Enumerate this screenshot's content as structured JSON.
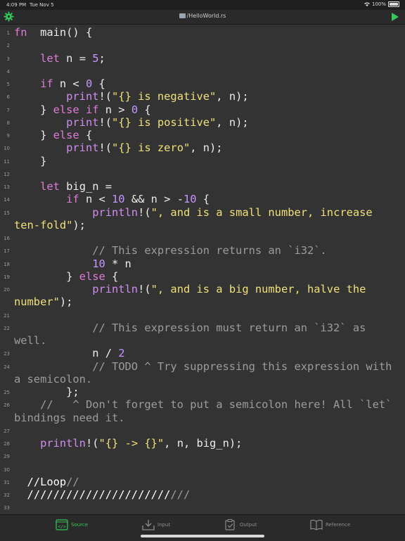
{
  "status_bar": {
    "time": "4:09 PM",
    "date": "Tue Nov 5",
    "battery": "100%"
  },
  "title_bar": {
    "file_path": "/HelloWorld.rs"
  },
  "code_lines": [
    {
      "n": "1",
      "parts": [
        [
          "kw",
          "fn"
        ],
        [
          "",
          "  main() {"
        ]
      ]
    },
    {
      "n": "2",
      "parts": []
    },
    {
      "n": "3",
      "parts": [
        [
          "",
          "    "
        ],
        [
          "kw",
          "let"
        ],
        [
          "",
          " n = "
        ],
        [
          "num",
          "5"
        ],
        [
          "",
          ";"
        ]
      ]
    },
    {
      "n": "4",
      "parts": []
    },
    {
      "n": "5",
      "parts": [
        [
          "",
          "    "
        ],
        [
          "kw",
          "if"
        ],
        [
          "",
          " n < "
        ],
        [
          "num",
          "0"
        ],
        [
          "",
          " {"
        ]
      ]
    },
    {
      "n": "6",
      "parts": [
        [
          "",
          "        "
        ],
        [
          "fn",
          "print"
        ],
        [
          "",
          "!("
        ],
        [
          "str",
          "\"{} is negative\""
        ],
        [
          "",
          ", n);"
        ]
      ]
    },
    {
      "n": "7",
      "parts": [
        [
          "",
          "    } "
        ],
        [
          "kw",
          "else if"
        ],
        [
          "",
          " n > "
        ],
        [
          "num",
          "0"
        ],
        [
          "",
          " {"
        ]
      ]
    },
    {
      "n": "8",
      "parts": [
        [
          "",
          "        "
        ],
        [
          "fn",
          "print"
        ],
        [
          "",
          "!("
        ],
        [
          "str",
          "\"{} is positive\""
        ],
        [
          "",
          ", n);"
        ]
      ]
    },
    {
      "n": "9",
      "parts": [
        [
          "",
          "    } "
        ],
        [
          "kw",
          "else"
        ],
        [
          "",
          " {"
        ]
      ]
    },
    {
      "n": "10",
      "parts": [
        [
          "",
          "        "
        ],
        [
          "fn",
          "print"
        ],
        [
          "",
          "!("
        ],
        [
          "str",
          "\"{} is zero\""
        ],
        [
          "",
          ", n);"
        ]
      ]
    },
    {
      "n": "11",
      "parts": [
        [
          "",
          "    }"
        ]
      ]
    },
    {
      "n": "12",
      "parts": []
    },
    {
      "n": "13",
      "parts": [
        [
          "",
          "    "
        ],
        [
          "kw",
          "let"
        ],
        [
          "",
          " big_n ="
        ]
      ]
    },
    {
      "n": "14",
      "parts": [
        [
          "",
          "        "
        ],
        [
          "kw",
          "if"
        ],
        [
          "",
          " n < "
        ],
        [
          "num",
          "10"
        ],
        [
          "",
          " && n > -"
        ],
        [
          "num",
          "10"
        ],
        [
          "",
          " {"
        ]
      ]
    },
    {
      "n": "15",
      "parts": [
        [
          "",
          "            "
        ],
        [
          "fn",
          "println"
        ],
        [
          "",
          "!("
        ],
        [
          "str",
          "\", and is a small number, increase"
        ]
      ]
    },
    {
      "n": "",
      "parts": [
        [
          "str",
          "ten-fold\""
        ],
        [
          "",
          ");"
        ]
      ]
    },
    {
      "n": "16",
      "parts": []
    },
    {
      "n": "17",
      "parts": [
        [
          "",
          "            "
        ],
        [
          "cmt",
          "// This expression returns an `i32`."
        ]
      ]
    },
    {
      "n": "18",
      "parts": [
        [
          "",
          "            "
        ],
        [
          "num",
          "10"
        ],
        [
          "",
          " * n"
        ]
      ]
    },
    {
      "n": "19",
      "parts": [
        [
          "",
          "        } "
        ],
        [
          "kw",
          "else"
        ],
        [
          "",
          " {"
        ]
      ]
    },
    {
      "n": "20",
      "parts": [
        [
          "",
          "            "
        ],
        [
          "fn",
          "println"
        ],
        [
          "",
          "!("
        ],
        [
          "str",
          "\", and is a big number, halve the"
        ]
      ]
    },
    {
      "n": "",
      "parts": [
        [
          "str",
          "number\""
        ],
        [
          "",
          ");"
        ]
      ]
    },
    {
      "n": "21",
      "parts": []
    },
    {
      "n": "22",
      "parts": [
        [
          "",
          "            "
        ],
        [
          "cmt",
          "// This expression must return an `i32` as"
        ]
      ]
    },
    {
      "n": "",
      "parts": [
        [
          "cmt",
          "well."
        ]
      ]
    },
    {
      "n": "23",
      "parts": [
        [
          "",
          "            n / "
        ],
        [
          "num",
          "2"
        ]
      ]
    },
    {
      "n": "24",
      "parts": [
        [
          "",
          "            "
        ],
        [
          "cmt",
          "// TODO ^ Try suppressing this expression with"
        ]
      ]
    },
    {
      "n": "",
      "parts": [
        [
          "cmt",
          "a semicolon."
        ]
      ]
    },
    {
      "n": "25",
      "parts": [
        [
          "",
          "        };"
        ]
      ]
    },
    {
      "n": "26",
      "parts": [
        [
          "",
          "    "
        ],
        [
          "cmt",
          "//   ^ Don't forget to put a semicolon here! All `let`"
        ]
      ]
    },
    {
      "n": "",
      "parts": [
        [
          "cmt",
          "bindings need it."
        ]
      ]
    },
    {
      "n": "27",
      "parts": []
    },
    {
      "n": "28",
      "parts": [
        [
          "",
          "    "
        ],
        [
          "fn",
          "println"
        ],
        [
          "",
          "!("
        ],
        [
          "str",
          "\"{} -> {}\""
        ],
        [
          "",
          ", n, big_n);"
        ]
      ]
    },
    {
      "n": "29",
      "parts": []
    },
    {
      "n": "30",
      "parts": []
    },
    {
      "n": "31",
      "parts": [
        [
          "",
          "  "
        ],
        [
          "loop",
          "//Loop"
        ],
        [
          "cmt",
          "//"
        ]
      ]
    },
    {
      "n": "32",
      "parts": [
        [
          "",
          "  "
        ],
        [
          "loop",
          "//////////////////////"
        ],
        [
          "cmt",
          "///"
        ]
      ]
    },
    {
      "n": "33",
      "parts": []
    }
  ],
  "tabs": [
    {
      "label": "Source",
      "active": true
    },
    {
      "label": "Input",
      "active": false
    },
    {
      "label": "Output",
      "active": false
    },
    {
      "label": "Reference",
      "active": false
    }
  ],
  "colors": {
    "accent_green": "#34c759",
    "keyword": "#e07cd8",
    "number": "#c596ff",
    "string": "#f0e07a",
    "comment": "#9c9c9c"
  }
}
